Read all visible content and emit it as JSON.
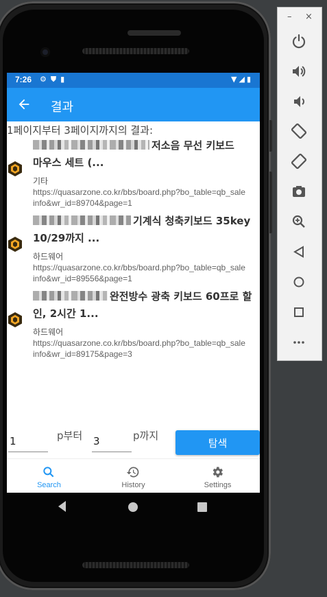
{
  "status_bar": {
    "time": "7:26",
    "left_icons": [
      "gear-icon",
      "shield-icon",
      "sim-icon"
    ],
    "right_icons": [
      "wifi-icon",
      "signal-icon",
      "battery-icon"
    ]
  },
  "app_bar": {
    "title": "결과"
  },
  "summary": "1페이지부터 3페이지까지의 결과:",
  "results": [
    {
      "title_visible": "저소음 무선 키보드 마우스 세트 (...",
      "title_line1": "저소음 무선 키보드",
      "title_line2": "마우스 세트 (...",
      "category": "기타",
      "url": "https://quasarzone.co.kr/bbs/board.php?bo_table=qb_saleinfo&wr_id=89704&page=1"
    },
    {
      "title_visible": "기계식 청축키보드 35key 10/29까지 ...",
      "title_line1": "기계식 청축키보드 35key",
      "title_line2": "10/29까지 ...",
      "category": "하드웨어",
      "url": "https://quasarzone.co.kr/bbs/board.php?bo_table=qb_saleinfo&wr_id=89556&page=1"
    },
    {
      "title_visible": "완전방수 광축 키보드 60프로 할인, 2시간 1...",
      "title_line1": "완전방수 광축 키보드 60프로 할",
      "title_line2": "인, 2시간 1...",
      "category": "하드웨어",
      "url": "https://quasarzone.co.kr/bbs/board.php?bo_table=qb_saleinfo&wr_id=89175&page=3"
    }
  ],
  "form": {
    "start_value": "1",
    "start_suffix": "p부터",
    "end_value": "3",
    "end_suffix": "p까지",
    "search_button": "탐색"
  },
  "bottom_nav": [
    {
      "label": "Search",
      "icon": "search-icon",
      "active": true
    },
    {
      "label": "History",
      "icon": "history-icon",
      "active": false
    },
    {
      "label": "Settings",
      "icon": "settings-icon",
      "active": false
    }
  ],
  "device_nav": [
    "back-icon",
    "home-icon",
    "recents-icon"
  ],
  "emulator_panel": {
    "window_controls": [
      "minimize-icon",
      "close-icon"
    ],
    "buttons": [
      "power-icon",
      "volume-up-icon",
      "volume-down-icon",
      "rotate-left-icon",
      "rotate-right-icon",
      "camera-icon",
      "zoom-icon",
      "back-icon",
      "home-icon",
      "overview-icon",
      "more-icon"
    ]
  },
  "colors": {
    "primary": "#2196f3",
    "primary_dark": "#1976d2",
    "background": "#3c3f41"
  }
}
